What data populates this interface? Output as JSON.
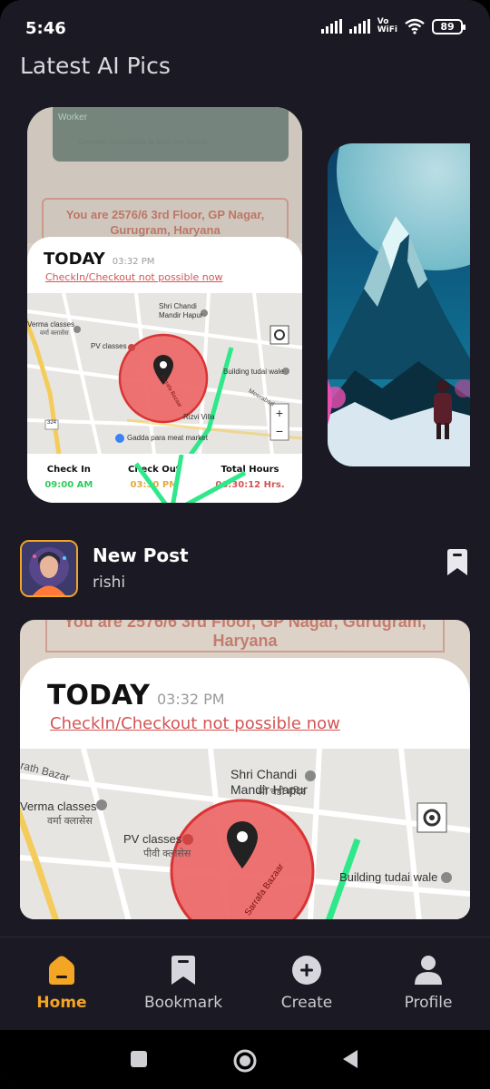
{
  "status_bar": {
    "time": "5:46",
    "vowifi": "Vo\nWiFi",
    "battery": "89"
  },
  "section": {
    "title": "Latest AI Pics"
  },
  "screenshot_card": {
    "faded_status": "Currently unavailable to fetch the Status.",
    "worker_label": "Worker",
    "address": "You are 2576/6 3rd Floor, GP Nagar, Gurugram, Haryana",
    "today": "TODAY",
    "time": "03:32 PM",
    "warning": "CheckIn/Checkout not possible now",
    "map_labels": {
      "temple": "Shri Chandi Mandir Hapur",
      "temple_hindi": "श्री चंडी मंदिर",
      "classes": "Verma classes",
      "classes_hindi": "वर्मा क्लासेस",
      "pv": "PV classes",
      "pv_hindi": "पीवी क्लासेस",
      "building": "Building tudai wale",
      "rizvi": "Rizvi Villa",
      "gadda": "Gadda para meat market",
      "street": "Sarrafa Bazaar",
      "road": "Meerabad",
      "bazar": "rath Bazar",
      "road_num": "324"
    },
    "check_in_label": "Check In",
    "check_in_value": "09:00 AM",
    "check_out_label": "Check Out",
    "check_out_value": "03:30 PM",
    "total_label": "Total Hours",
    "total_value": "06:30:12 Hrs."
  },
  "post": {
    "title": "New Post",
    "author": "rishi",
    "address": "You are 2576/6 3rd Floor, GP Nagar, Gurugram, Haryana",
    "today": "TODAY",
    "time": "03:32 PM",
    "warning": "CheckIn/Checkout not possible now"
  },
  "nav": {
    "items": [
      {
        "label": "Home",
        "icon": "home-icon"
      },
      {
        "label": "Bookmark",
        "icon": "bookmark-icon"
      },
      {
        "label": "Create",
        "icon": "plus-circle-icon"
      },
      {
        "label": "Profile",
        "icon": "person-icon"
      }
    ]
  },
  "colors": {
    "accent": "#f5a524",
    "background": "#1b1a24",
    "warning": "#d45454",
    "green": "#2ee88a"
  }
}
